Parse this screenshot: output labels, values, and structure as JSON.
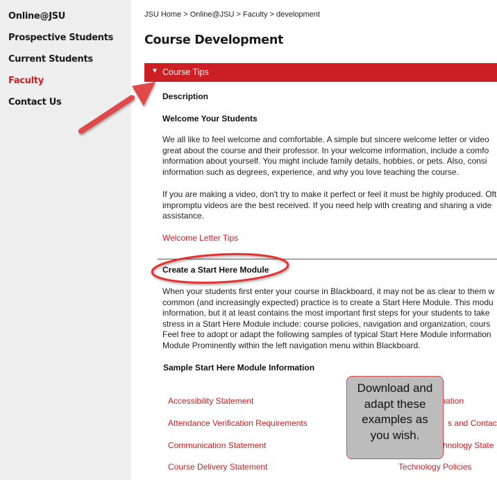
{
  "sidebar": {
    "items": [
      {
        "label": "Online@JSU"
      },
      {
        "label": "Prospective Students"
      },
      {
        "label": "Current Students"
      },
      {
        "label": "Faculty"
      },
      {
        "label": "Contact Us"
      }
    ]
  },
  "breadcrumb": "JSU Home > Online@JSU > Faculty > development",
  "page_title": "Course Development",
  "tips_bar": {
    "label": "Course Tips"
  },
  "content": {
    "description_heading": "Description",
    "welcome_heading": "Welcome Your Students",
    "welcome_p1": [
      "We all like to feel welcome and comfortable. A simple but sincere welcome letter or video",
      "great about the course and their professor. In your welcome information, include a comfo",
      "information about yourself. You might include family details, hobbies, or pets. Also, consi",
      "information such as degrees, experience, and why you love teaching the course."
    ],
    "welcome_p2": [
      "If you are making a video, don't try to make it perfect or feel it must be highly produced. Oft",
      "impromptu videos are the best received. If you need help with creating and sharing a vide",
      "assistance."
    ],
    "welcome_link": "Welcome Letter Tips",
    "start_heading": "Create a Start Here Module",
    "start_p": [
      "When your students first enter your course in Blackboard, it may not be as clear to them w",
      "common (and increasingly expected) practice is to create a Start Here Module. This modu",
      "information, but it at least contains the most important first steps for your students to take",
      "stress in a Start Here Module include: course policies, navigation and organization, cours",
      "Feel free to adopt or adapt the following samples of typical Start Here Module information",
      "Module Prominently within the left navigation menu within Blackboard."
    ],
    "sample_heading": "Sample Start Here Module Information",
    "sample_links_left": [
      "Accessibility Statement",
      "Attendance Verification Requirements",
      "Communication Statement",
      "Course Delivery Statement"
    ],
    "sample_links_right": [
      "rmation",
      "s and Contact I",
      "chnology State",
      "Technology Policies"
    ]
  },
  "callout": {
    "lines": [
      "Download and",
      "adapt these",
      "examples as",
      "you wish."
    ]
  },
  "colors": {
    "accent": "#cc1f24",
    "sidebar_bg": "#eeeeee",
    "callout_bg": "#bcbcbc",
    "annotation": "#e04848"
  }
}
